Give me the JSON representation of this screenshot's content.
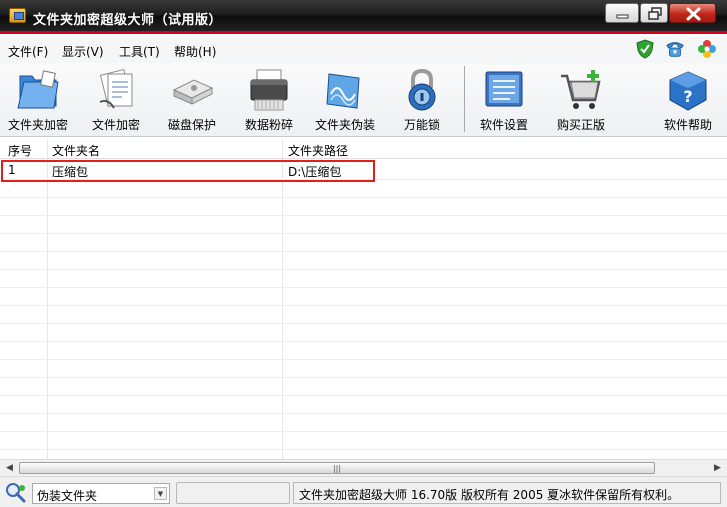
{
  "window": {
    "title": "文件夹加密超级大师（试用版）"
  },
  "menu": {
    "items": [
      "文件(F)",
      "显示(V)",
      "工具(T)",
      "帮助(H)"
    ]
  },
  "toolbar": {
    "items": [
      {
        "label": "文件夹加密",
        "icon": "folder-encrypt-icon"
      },
      {
        "label": "文件加密",
        "icon": "file-encrypt-icon"
      },
      {
        "label": "磁盘保护",
        "icon": "disk-protect-icon"
      },
      {
        "label": "数据粉碎",
        "icon": "shredder-icon"
      },
      {
        "label": "文件夹伪装",
        "icon": "folder-disguise-icon"
      },
      {
        "label": "万能锁",
        "icon": "padlock-icon"
      },
      {
        "label": "软件设置",
        "icon": "settings-icon"
      },
      {
        "label": "购买正版",
        "icon": "cart-icon"
      },
      {
        "label": "软件帮助",
        "icon": "help-icon"
      }
    ]
  },
  "list": {
    "columns": [
      "序号",
      "文件夹名",
      "文件夹路径"
    ],
    "rows": [
      {
        "index": "1",
        "name": "压缩包",
        "path": "D:\\压缩包"
      }
    ]
  },
  "statusbar": {
    "mode_value": "伪装文件夹",
    "empty_panel": "",
    "info_text": "文件夹加密超级大师 16.70版 版权所有 2005 夏冰软件保留所有权利。"
  },
  "colors": {
    "title_accent": "#d8001f",
    "highlight": "#e0201a"
  }
}
